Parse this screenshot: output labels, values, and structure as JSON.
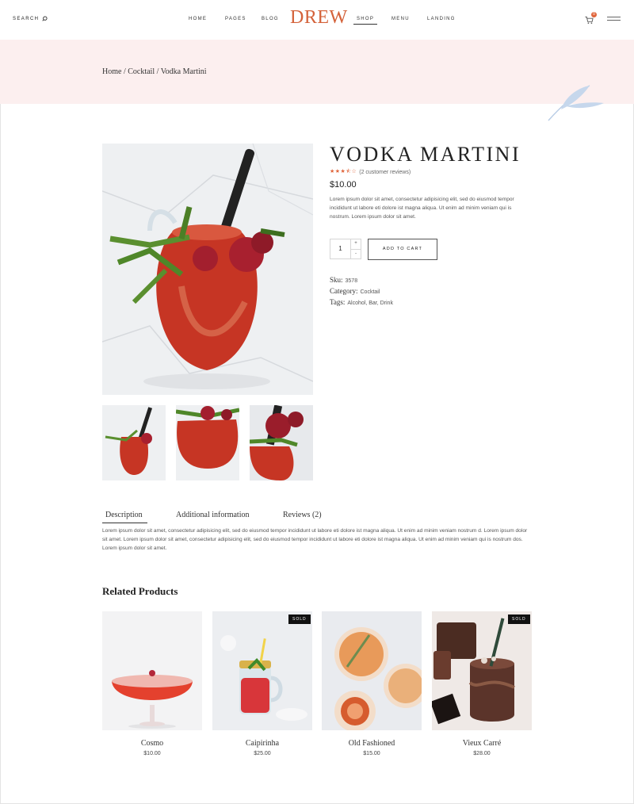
{
  "header": {
    "search_label": "SEARCH",
    "nav": [
      "HOME",
      "PAGES",
      "BLOG",
      "SHOP",
      "MENU",
      "LANDING"
    ],
    "logo": "DREW",
    "cart_count": "0"
  },
  "breadcrumb": "Home / Cocktail / Vodka Martini",
  "product": {
    "title": "VODKA MARTINI",
    "rating": 3.5,
    "stars_display": "★★★⯪☆",
    "reviews_link": "(2 customer reviews)",
    "price": "$10.00",
    "short_description": "Lorem ipsum dolor sit amet, consectetur adipisicing elit, sed do eiusmod tempor incididunt ut labore eti dolore ist magna aliqua. Ut enim ad minim veniam qui is nostrum. Lorem ipsum dolor sit amet.",
    "quantity": "1",
    "qty_plus": "+",
    "qty_minus": "-",
    "add_to_cart": "ADD TO CART",
    "sku_label": "Sku:",
    "sku": "3578",
    "category_label": "Category:",
    "category": "Cocktail",
    "tags_label": "Tags:",
    "tags": "Alcohol, Bar, Drink"
  },
  "tabs": {
    "items": [
      "Description",
      "Additional information",
      "Reviews (2)"
    ],
    "active": "Description",
    "content": "Lorem ipsum dolor sit amet, consectetur adipisicing elit, sed do eiusmod tempor incididunt ut labore eti dolore ist magna aliqua. Ut enim ad minim veniam nostrum d. Lorem ipsum dolor sit amet. Lorem ipsum dolor sit amet, consectetur adipisicing elit, sed do eiusmod tempor incididunt ut labore eti dolore ist magna aliqua. Ut enim ad minim veniam qui is nostrum dos. Lorem ipsum dolor sit amet."
  },
  "related": {
    "title": "Related Products",
    "items": [
      {
        "name": "Cosmo",
        "price": "$10.00",
        "badge": ""
      },
      {
        "name": "Caipirinha",
        "price": "$25.00",
        "badge": "SOLD"
      },
      {
        "name": "Old Fashioned",
        "price": "$15.00",
        "badge": ""
      },
      {
        "name": "Vieux Carré",
        "price": "$28.00",
        "badge": "SOLD"
      }
    ]
  },
  "colors": {
    "brand": "#d4623a",
    "band": "#fcefef",
    "star": "#e0643a"
  }
}
